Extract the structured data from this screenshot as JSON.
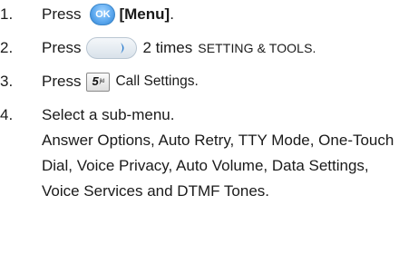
{
  "steps": [
    {
      "number": "1.",
      "text_before": "Press",
      "key_label": "OK",
      "menu_label": "[Menu]",
      "end": "."
    },
    {
      "number": "2.",
      "text_before": "Press",
      "count_text": "2 times",
      "target": "SETTING & TOOLS."
    },
    {
      "number": "3.",
      "text_before": "Press",
      "key_digit": "5",
      "key_letters": "jkl",
      "target": "Call Settings."
    },
    {
      "number": "4.",
      "text": "Select a sub-menu.",
      "submenu": "Answer Options, Auto Retry, TTY Mode, One-Touch Dial, Voice Privacy, Auto Volume, Data Settings, Voice Services and DTMF Tones."
    }
  ],
  "icons": {
    "ok_key_color": "#5eaaf0",
    "nav_key_color": "#e6edf3",
    "nav_arrow_color": "#2f7fcf"
  }
}
